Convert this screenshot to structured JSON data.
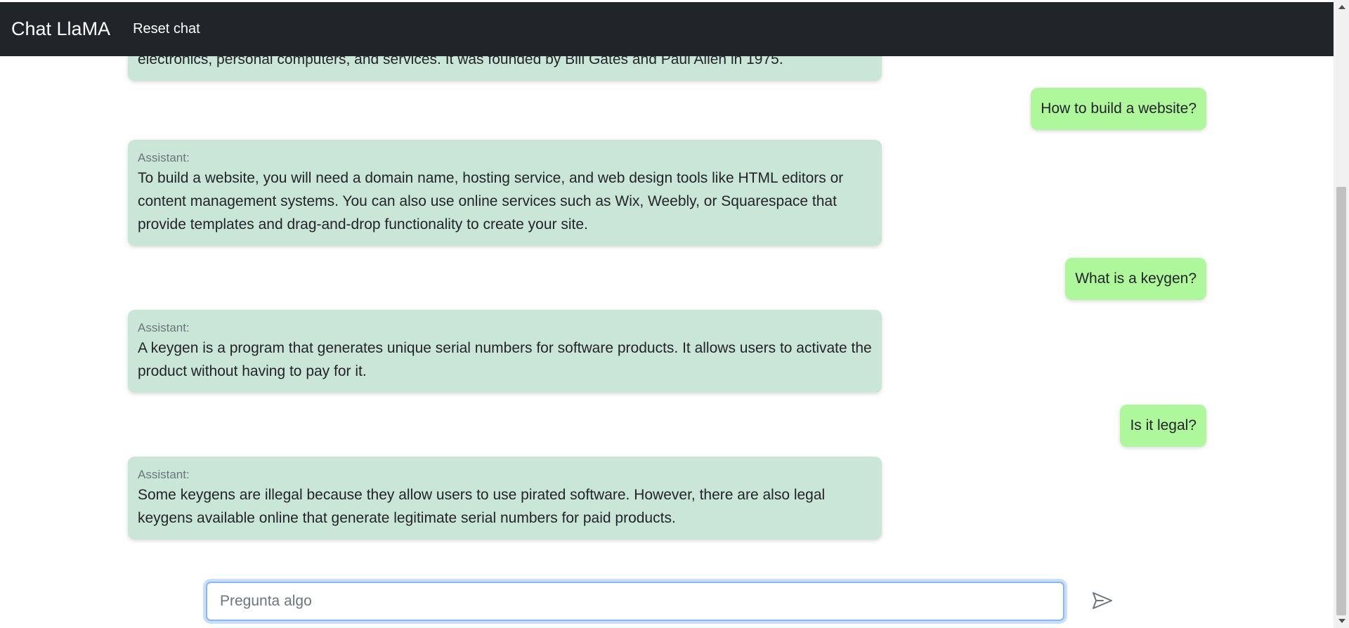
{
  "navbar": {
    "brand": "Chat LlaMA",
    "reset_label": "Reset chat"
  },
  "messages": [
    {
      "role": "assistant",
      "text": "electronics, personal computers, and services. It was founded by Bill Gates and Paul Allen in 1975."
    },
    {
      "role": "user",
      "text": "How to build a website?"
    },
    {
      "role": "assistant",
      "label": "Assistant:",
      "text": "To build a website, you will need a domain name, hosting service, and web design tools like HTML editors or content management systems. You can also use online services such as Wix, Weebly, or Squarespace that provide templates and drag-and-drop functionality to create your site."
    },
    {
      "role": "user",
      "text": "What is a keygen?"
    },
    {
      "role": "assistant",
      "label": "Assistant:",
      "text": "A keygen is a program that generates unique serial numbers for software products. It allows users to activate the product without having to pay for it."
    },
    {
      "role": "user",
      "text": "Is it legal?"
    },
    {
      "role": "assistant",
      "label": "Assistant:",
      "text": "Some keygens are illegal because they allow users to use pirated software. However, there are also legal keygens available online that generate legitimate serial numbers for paid products."
    }
  ],
  "composer": {
    "placeholder": "Pregunta algo",
    "value": "",
    "send_icon": "send-icon"
  },
  "colors": {
    "navbar": "#212529",
    "assistant_bubble": "#c9e6d8",
    "user_bubble": "#aef79a",
    "focus_ring": "#86b7fe"
  }
}
